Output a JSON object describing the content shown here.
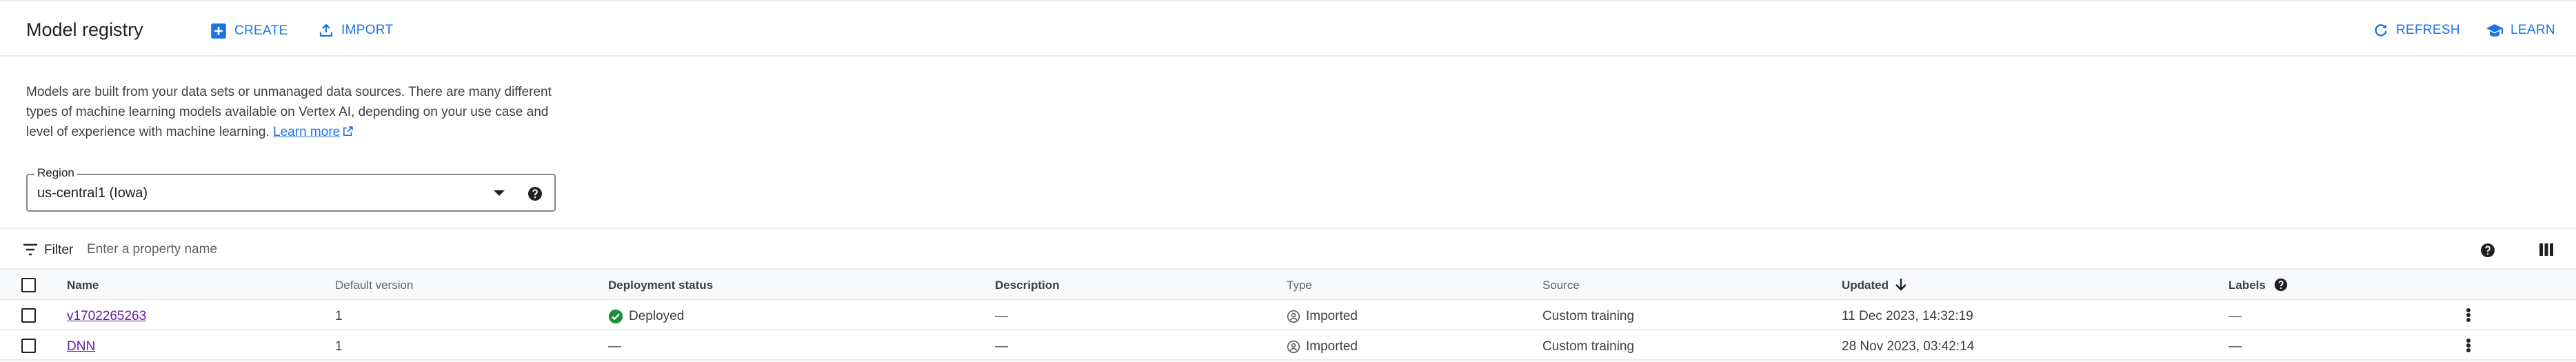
{
  "header": {
    "title": "Model registry",
    "create_label": "CREATE",
    "import_label": "IMPORT",
    "refresh_label": "REFRESH",
    "learn_label": "LEARN"
  },
  "intro": {
    "text": "Models are built from your data sets or unmanaged data sources. There are many different types of machine learning models available on Vertex AI, depending on your use case and level of experience with machine learning.",
    "link_label": "Learn more"
  },
  "region": {
    "label": "Region",
    "value": "us-central1 (Iowa)"
  },
  "filter": {
    "label": "Filter",
    "placeholder": "Enter a property name"
  },
  "table": {
    "columns": {
      "name": "Name",
      "default_version": "Default version",
      "deployment_status": "Deployment status",
      "description": "Description",
      "type": "Type",
      "source": "Source",
      "updated": "Updated",
      "labels": "Labels"
    },
    "rows": [
      {
        "name": "v1702265263",
        "default_version": "1",
        "deployment_status": "Deployed",
        "description": "—",
        "type": "Imported",
        "source": "Custom training",
        "updated": "11 Dec 2023, 14:32:19",
        "labels": "—"
      },
      {
        "name": "DNN",
        "default_version": "1",
        "deployment_status": "—",
        "description": "—",
        "type": "Imported",
        "source": "Custom training",
        "updated": "28 Nov 2023, 03:42:14",
        "labels": "—"
      }
    ]
  },
  "colors": {
    "accent": "#1a73e8",
    "visited_link": "#681da8",
    "deployed_green": "#1e8e3e"
  },
  "icons": [
    "add-box-icon",
    "upload-icon",
    "refresh-icon",
    "school-icon",
    "external-link-icon",
    "help-icon",
    "filter-list-icon",
    "column-toggle-icon",
    "arrow-down-icon",
    "check-circle-icon",
    "imported-icon",
    "more-vert-icon"
  ]
}
